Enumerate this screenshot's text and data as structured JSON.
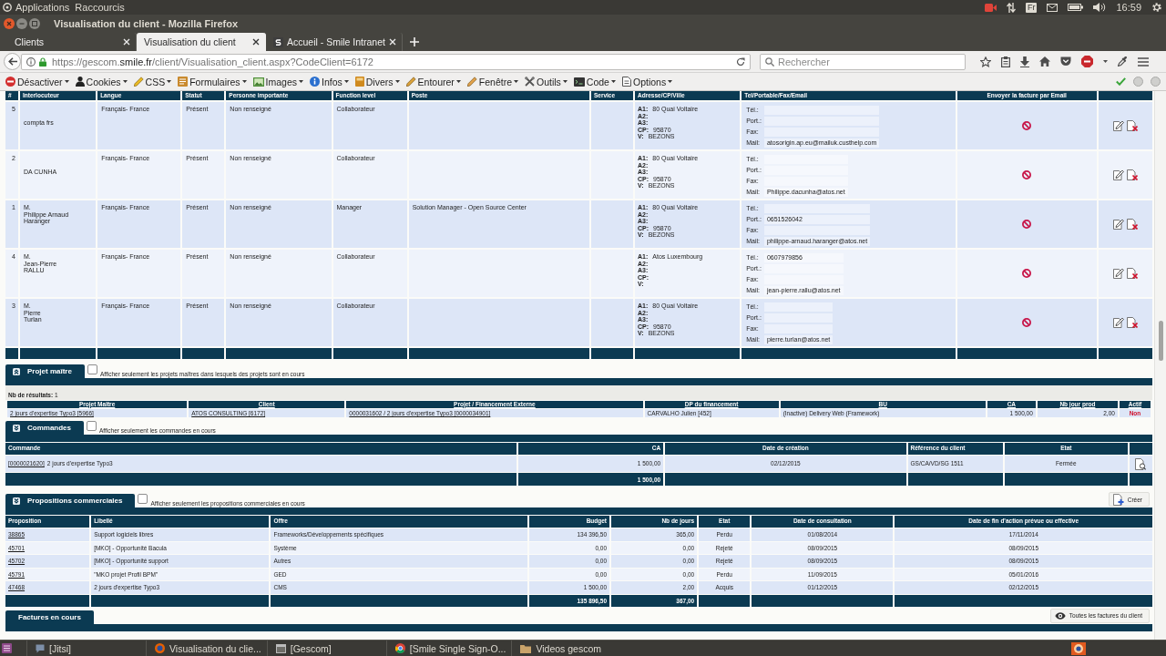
{
  "top_panel": {
    "menus": [
      "Applications",
      "Raccourcis"
    ],
    "keyboard_layout": "Fr",
    "clock": "16:59"
  },
  "window": {
    "title": "Visualisation du client - Mozilla Firefox"
  },
  "tabs": [
    {
      "label": "Clients",
      "selected": false,
      "favicon": false
    },
    {
      "label": "Visualisation du client",
      "selected": true,
      "favicon": false
    },
    {
      "label": "Accueil - Smile Intranet",
      "selected": false,
      "favicon": true
    }
  ],
  "address_bar": {
    "url_start": "https://gescom.",
    "url_domain": "smile.fr",
    "url_end": "/client/Visualisation_client.aspx?CodeClient=6172"
  },
  "search": {
    "placeholder": "Rechercher"
  },
  "developer_toolbar": {
    "menus": [
      "Désactiver",
      "Cookies",
      "CSS",
      "Formulaires",
      "Images",
      "Infos",
      "Divers",
      "Entourer",
      "Fenêtre",
      "Outils",
      "Code",
      "Options"
    ]
  },
  "contacts": {
    "columns": [
      "#",
      "Interlocuteur",
      "Langue",
      "Statut",
      "Personne importante",
      "Function level",
      "Poste",
      "Service",
      "Adresse/CP/Ville",
      "Tel/Portable/Fax/Email",
      "Envoyer la facture par Email"
    ],
    "rows": [
      {
        "number": "5",
        "last_name": "compta frs",
        "language": "Français- France",
        "status": "Présent",
        "important": "Non renseigné",
        "function_level": "Collaborateur",
        "address": [
          {
            "label": "A1:",
            "value": "80 Quai Voltaire"
          },
          {
            "label": "A2:"
          },
          {
            "label": "A3:"
          },
          {
            "label": "CP:",
            "value": "95870"
          },
          {
            "label": "V:",
            "value": "BEZONS"
          }
        ],
        "contact": [
          {
            "label": "Tél.:"
          },
          {
            "label": "Port.:"
          },
          {
            "label": "Fax:"
          },
          {
            "label": "Mail:",
            "value": "atosorigin.ap.eu@mailuk.custhelp.com"
          }
        ],
        "invoice_by_email": false
      },
      {
        "number": "2",
        "last_name": "DA CUNHA",
        "language": "Français- France",
        "status": "Présent",
        "important": "Non renseigné",
        "function_level": "Collaborateur",
        "address": [
          {
            "label": "A1:",
            "value": "80 Quai Voltaire"
          },
          {
            "label": "A2:"
          },
          {
            "label": "A3:"
          },
          {
            "label": "CP:",
            "value": "95870"
          },
          {
            "label": "V:",
            "value": "BEZONS"
          }
        ],
        "contact": [
          {
            "label": "Tél.:"
          },
          {
            "label": "Port.:"
          },
          {
            "label": "Fax:"
          },
          {
            "label": "Mail:",
            "value": "Philippe.dacunha@atos.net"
          }
        ],
        "invoice_by_email": false
      },
      {
        "number": "1",
        "civility": "M.",
        "first_name": "Philippe Arnaud",
        "last_name": "Haranger",
        "language": "Français- France",
        "status": "Présent",
        "important": "Non renseigné",
        "function_level": "Manager",
        "position": "Solution Manager - Open Source Center",
        "address": [
          {
            "label": "A1:",
            "value": "80 Quai Voltaire"
          },
          {
            "label": "A2:"
          },
          {
            "label": "A3:"
          },
          {
            "label": "CP:",
            "value": "95870"
          },
          {
            "label": "V:",
            "value": "BEZONS"
          }
        ],
        "contact": [
          {
            "label": "Tél.:"
          },
          {
            "label": "Port.:",
            "value": "0651526042"
          },
          {
            "label": "Fax:"
          },
          {
            "label": "Mail:",
            "value": "philippe-arnaud.haranger@atos.net"
          }
        ],
        "invoice_by_email": false
      },
      {
        "number": "4",
        "civility": "M.",
        "first_name": "Jean-Pierre",
        "last_name": "RALLU",
        "language": "Français- France",
        "status": "Présent",
        "important": "Non renseigné",
        "function_level": "Collaborateur",
        "address": [
          {
            "label": "A1:",
            "value": "Atos Luxembourg"
          },
          {
            "label": "A2:"
          },
          {
            "label": "A3:"
          },
          {
            "label": "CP:"
          },
          {
            "label": "V:"
          }
        ],
        "contact": [
          {
            "label": "Tél.:",
            "value": "0607979856"
          },
          {
            "label": "Port.:"
          },
          {
            "label": "Fax:"
          },
          {
            "label": "Mail:",
            "value": "jean-pierre.rallu@atos.net"
          }
        ],
        "invoice_by_email": false
      },
      {
        "number": "3",
        "civility": "M.",
        "first_name": "Pierre",
        "last_name": "Turlan",
        "language": "Français- France",
        "status": "Présent",
        "important": "Non renseigné",
        "function_level": "Collaborateur",
        "address": [
          {
            "label": "A1:",
            "value": "80 Quai Voltaire"
          },
          {
            "label": "A2:"
          },
          {
            "label": "A3:"
          },
          {
            "label": "CP:",
            "value": "95870"
          },
          {
            "label": "V:",
            "value": "BEZONS"
          }
        ],
        "contact": [
          {
            "label": "Tél.:"
          },
          {
            "label": "Port.:"
          },
          {
            "label": "Fax:"
          },
          {
            "label": "Mail:",
            "value": "pierre.turlan@atos.net"
          }
        ],
        "invoice_by_email": false
      }
    ]
  },
  "projet_maitre": {
    "title": "Projet maître",
    "kind": "up",
    "filter": {
      "label": "Afficher seulement les projets maîtres dans lesquels des projets sont en cours",
      "checked": false
    },
    "result_count": "**Nb de résultats:** 1",
    "columns": [
      "Projet Maître",
      "Client",
      "Projet / Financement Externe",
      "DP du financement",
      "BU",
      "CA",
      "Nb jour prod",
      "Actif"
    ],
    "rows": [
      {
        "project": "2 jours d'expertise Typo3 [5966]",
        "client": "ATOS CONSULTING [6172]",
        "financing": "0000031602 / 2 jours d'expertise Typo3 [0000034901]",
        "manager": "CARVALHO Julien [452]",
        "bu": "(Inactive) Delivery Web (Framework)",
        "ca": "1 500,00",
        "days": "2,00",
        "active_label": "Non",
        "active": false
      }
    ]
  },
  "commandes": {
    "title": "Commandes",
    "kind": "down",
    "filter": {
      "label": "Afficher seulement les commandes en cours",
      "checked": false
    },
    "columns": [
      "Commande",
      "CA",
      "Date de création",
      "Référence du client",
      "Etat"
    ],
    "rows": [
      {
        "number": "[0000021620]",
        "label": "2 jours d'expertise Typo3",
        "ca": "1 500,00",
        "created": "02/12/2015",
        "reference": "GS/CA/VD/SG 1511",
        "status": "Fermée"
      }
    ],
    "totals": {
      "ca": "1 500,00"
    }
  },
  "propositions": {
    "title": "Propositions commerciales",
    "kind": "down",
    "filter": {
      "label": "Afficher seulement les propositions commerciales en cours",
      "checked": false
    },
    "create_button": "Créer",
    "columns": [
      "Proposition",
      "Libellé",
      "Offre",
      "Budget",
      "Nb de jours",
      "Etat",
      "Date de consultation",
      "Date de fin d'action prévue ou effective"
    ],
    "rows": [
      {
        "number": "38865",
        "label": "Support logiciels libres",
        "offer": "Frameworks/Développements spécifiques",
        "budget": "134 396,50",
        "days": "365,00",
        "status": "Perdu",
        "consulted": "01/08/2014",
        "end": "17/11/2014"
      },
      {
        "number": "45701",
        "label": "[MKO] - Opportunité Bacula",
        "offer": "Système",
        "budget": "0,00",
        "days": "0,00",
        "status": "Rejeté",
        "consulted": "08/09/2015",
        "end": "08/09/2015"
      },
      {
        "number": "45702",
        "label": "[MKO] - Opportunité support",
        "offer": "Autres",
        "budget": "0,00",
        "days": "0,00",
        "status": "Rejeté",
        "consulted": "08/09/2015",
        "end": "08/09/2015"
      },
      {
        "number": "45791",
        "label": "\"MKO projet Profil BPM\"",
        "offer": "GED",
        "budget": "0,00",
        "days": "0,00",
        "status": "Perdu",
        "consulted": "11/09/2015",
        "end": "05/01/2016"
      },
      {
        "number": "47468",
        "label": "2 jours d'expertise Typo3",
        "offer": "CMS",
        "budget": "1 500,00",
        "days": "2,00",
        "status": "Acquis",
        "consulted": "01/12/2015",
        "end": "02/12/2015"
      }
    ],
    "totals": {
      "budget": "135 896,50",
      "days": "367,00"
    }
  },
  "factures": {
    "title": "Factures en cours",
    "all_invoices_button": "Toutes les factures du client"
  },
  "taskbar": {
    "items": [
      "[Jitsi]",
      "Visualisation du clie...",
      "[Gescom]",
      "[Smile Single Sign-O...",
      "Videos gescom"
    ]
  }
}
